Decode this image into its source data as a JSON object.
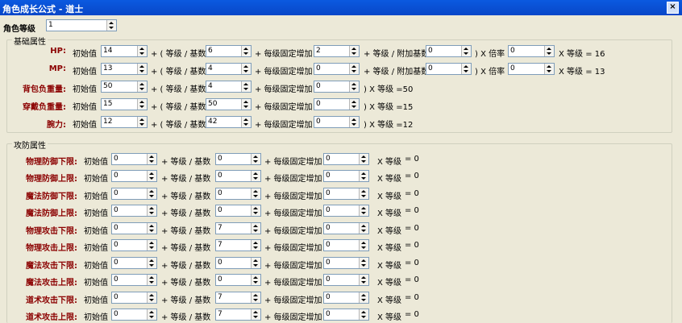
{
  "window": {
    "title": "角色成长公式 - 道士",
    "close_label": "×"
  },
  "level": {
    "label": "角色等级",
    "value": "1"
  },
  "basic": {
    "legend": "基础属性",
    "rows": [
      {
        "name": "HP:",
        "initial_label": "初始值",
        "initial": "14",
        "plus1": "+ ( 等级 / 基数",
        "base": "6",
        "plus2": "+ 每级固定增加",
        "fixed": "2",
        "extra_label": "+ 等级 / 附加基数",
        "extra": "0",
        "mult_label": ") X 倍率",
        "mult": "0",
        "result": "X 等级  =  16"
      },
      {
        "name": "MP:",
        "initial_label": "初始值",
        "initial": "13",
        "plus1": "+ ( 等级 / 基数",
        "base": "4",
        "plus2": "+ 每级固定增加",
        "fixed": "0",
        "extra_label": "+ 等级 / 附加基数",
        "extra": "0",
        "mult_label": ") X 倍率",
        "mult": "0",
        "result": "X 等级  =  13"
      },
      {
        "name": "背包负重量:",
        "initial_label": "初始值",
        "initial": "50",
        "plus1": "+ ( 等级 / 基数",
        "base": "4",
        "plus2": "+ 每级固定增加",
        "fixed": "0",
        "result": ") X 等级  =50"
      },
      {
        "name": "穿戴负重量:",
        "initial_label": "初始值",
        "initial": "15",
        "plus1": "+ ( 等级 / 基数",
        "base": "50",
        "plus2": "+ 每级固定增加",
        "fixed": "0",
        "result": ") X 等级  =15"
      },
      {
        "name": "腕力:",
        "initial_label": "初始值",
        "initial": "12",
        "plus1": "+ ( 等级 / 基数",
        "base": "42",
        "plus2": "+ 每级固定增加",
        "fixed": "0",
        "result": ") X 等级  =12"
      }
    ]
  },
  "attack": {
    "legend": "攻防属性",
    "rows": [
      {
        "name": "物理防御下限:",
        "initial_label": "初始值",
        "initial": "0",
        "plus1": "+  等级 / 基数",
        "base": "0",
        "plus2": "+ 每级固定增加",
        "fixed": "0",
        "mult_label": "X 等级",
        "result": "=  0"
      },
      {
        "name": "物理防御上限:",
        "initial_label": "初始值",
        "initial": "0",
        "plus1": "+  等级 / 基数",
        "base": "0",
        "plus2": "+ 每级固定增加",
        "fixed": "0",
        "mult_label": "X 等级",
        "result": "=  0"
      },
      {
        "name": "魔法防御下限:",
        "initial_label": "初始值",
        "initial": "0",
        "plus1": "+  等级 / 基数",
        "base": "0",
        "plus2": "+ 每级固定增加",
        "fixed": "0",
        "mult_label": "X 等级",
        "result": "=  0"
      },
      {
        "name": "魔法防御上限:",
        "initial_label": "初始值",
        "initial": "0",
        "plus1": "+  等级 / 基数",
        "base": "0",
        "plus2": "+ 每级固定增加",
        "fixed": "0",
        "mult_label": "X 等级",
        "result": "=  0"
      },
      {
        "name": "物理攻击下限:",
        "initial_label": "初始值",
        "initial": "0",
        "plus1": "+  等级 / 基数",
        "base": "7",
        "plus2": "+ 每级固定增加",
        "fixed": "0",
        "mult_label": "X 等级",
        "result": "=  0"
      },
      {
        "name": "物理攻击上限:",
        "initial_label": "初始值",
        "initial": "0",
        "plus1": "+  等级 / 基数",
        "base": "7",
        "plus2": "+ 每级固定增加",
        "fixed": "0",
        "mult_label": "X 等级",
        "result": "=  0"
      },
      {
        "name": "魔法攻击下限:",
        "initial_label": "初始值",
        "initial": "0",
        "plus1": "+  等级 / 基数",
        "base": "0",
        "plus2": "+ 每级固定增加",
        "fixed": "0",
        "mult_label": "X 等级",
        "result": "=  0"
      },
      {
        "name": "魔法攻击上限:",
        "initial_label": "初始值",
        "initial": "0",
        "plus1": "+  等级 / 基数",
        "base": "0",
        "plus2": "+ 每级固定增加",
        "fixed": "0",
        "mult_label": "X 等级",
        "result": "=  0"
      },
      {
        "name": "道术攻击下限:",
        "initial_label": "初始值",
        "initial": "0",
        "plus1": "+  等级 / 基数",
        "base": "7",
        "plus2": "+ 每级固定增加",
        "fixed": "0",
        "mult_label": "X 等级",
        "result": "=  0"
      },
      {
        "name": "道术攻击上限:",
        "initial_label": "初始值",
        "initial": "0",
        "plus1": "+  等级 / 基数",
        "base": "7",
        "plus2": "+ 每级固定增加",
        "fixed": "0",
        "mult_label": "X 等级",
        "result": "=  0"
      }
    ]
  }
}
